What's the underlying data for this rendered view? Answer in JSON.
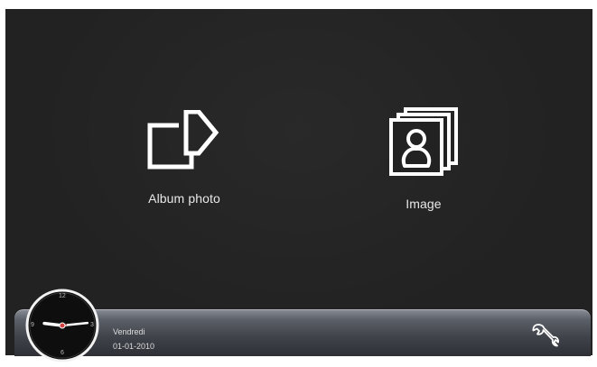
{
  "menu": {
    "album": {
      "label": "Album photo",
      "icon": "album-share-icon"
    },
    "image": {
      "label": "Image",
      "icon": "image-portrait-icon"
    }
  },
  "status": {
    "day": "Vendredi",
    "date": "01-01-2010"
  },
  "clock": {
    "numerals": {
      "top": "12",
      "right": "3",
      "bottom": "6",
      "left": "9"
    },
    "time": {
      "hour": 9,
      "minute": 14
    }
  },
  "settings": {
    "icon": "wrench-icon"
  },
  "colors": {
    "background": "#222222",
    "bar_top": "#8a8e96",
    "bar_bottom": "#2e3036",
    "icon_stroke": "#ffffff",
    "second_hand": "#d24040"
  }
}
